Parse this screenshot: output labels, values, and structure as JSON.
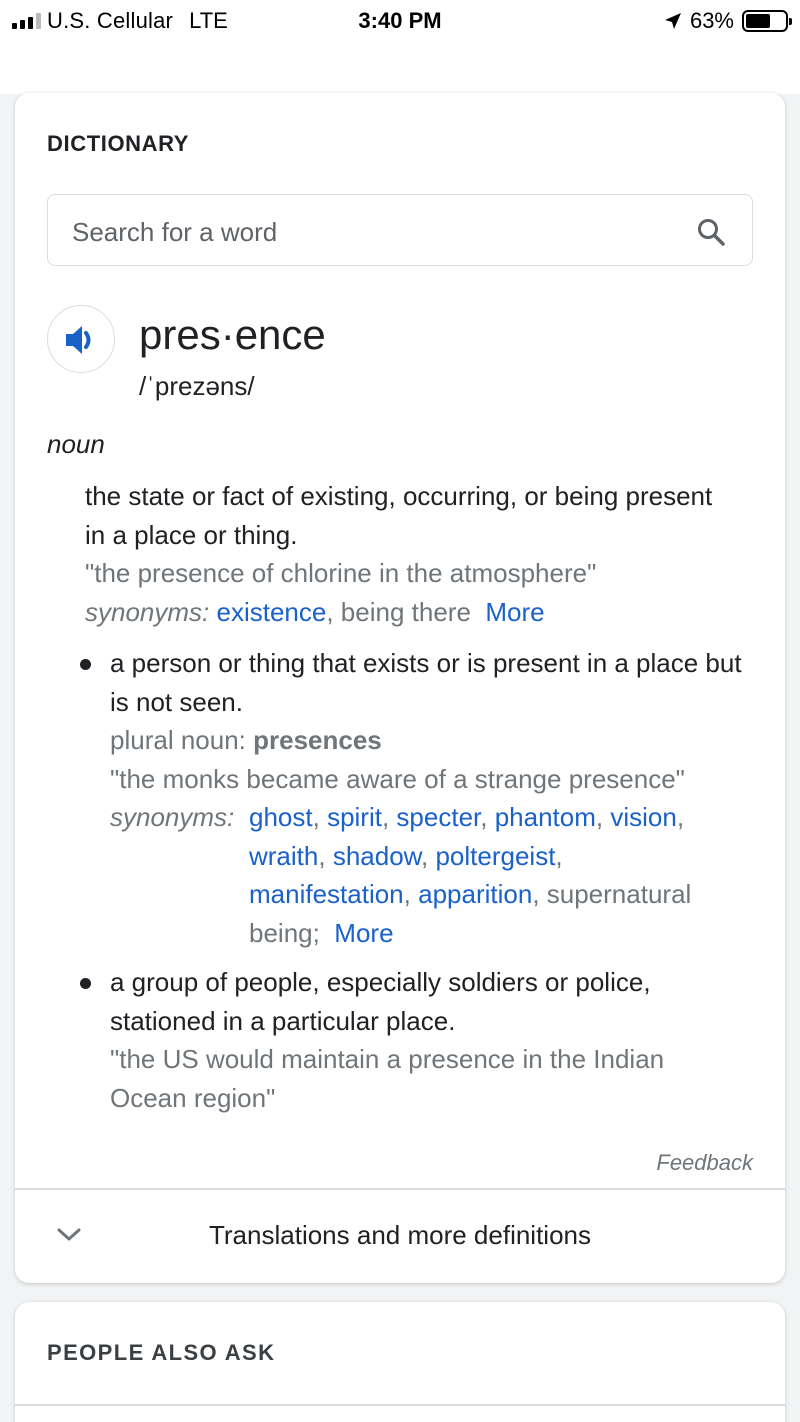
{
  "status_bar": {
    "carrier": "U.S. Cellular",
    "network": "LTE",
    "time": "3:40 PM",
    "battery": "63%",
    "battery_level": 0.63,
    "signal_bars": 3,
    "signal_max": 4
  },
  "dictionary": {
    "title": "DICTIONARY",
    "search_placeholder": "Search for a word",
    "headword": "pres·ence",
    "phonetic": "/ˈprezəns/",
    "part_of_speech": "noun",
    "sense1": {
      "definition": "the state or fact of existing, occurring, or being present in a place or thing.",
      "example": "\"the presence of chlorine in the atmosphere\"",
      "synonyms_label": "synonyms:",
      "synonym_link": "existence",
      "synonym_plain": "being there",
      "more": "More"
    },
    "sense2": {
      "definition": "a person or thing that exists or is present in a place but is not seen.",
      "plural_label": "plural noun:",
      "plural_value": "presences",
      "example": "\"the monks became aware of a strange presence\"",
      "synonyms_label": "synonyms:",
      "synonyms": [
        "ghost",
        "spirit",
        "specter",
        "phantom",
        "vision",
        "wraith",
        "shadow",
        "poltergeist",
        "manifestation",
        "apparition"
      ],
      "synonym_plain_1": "supernatural",
      "synonym_plain_2": "being;",
      "more": "More"
    },
    "sense3": {
      "definition": "a group of people, especially soldiers or police, stationed in a particular place.",
      "example": "\"the US would maintain a presence in the Indian Ocean region\""
    },
    "feedback": "Feedback",
    "expand_label": "Translations and more definitions"
  },
  "people_also_ask": {
    "title": "PEOPLE ALSO ASK"
  },
  "colors": {
    "link": "#1a61c9",
    "muted": "#70757a",
    "text": "#202124"
  }
}
